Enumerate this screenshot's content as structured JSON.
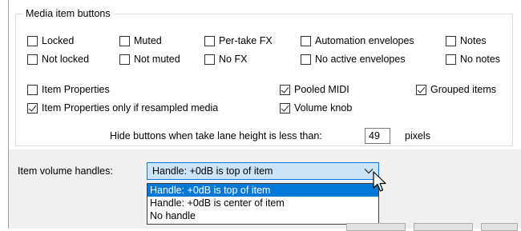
{
  "media_item_buttons": {
    "title": "Media item buttons",
    "row1": [
      {
        "label": "Locked",
        "checked": false
      },
      {
        "label": "Muted",
        "checked": false
      },
      {
        "label": "Per-take FX",
        "checked": false
      },
      {
        "label": "Automation envelopes",
        "checked": false
      },
      {
        "label": "Notes",
        "checked": false
      }
    ],
    "row2": [
      {
        "label": "Not locked",
        "checked": false
      },
      {
        "label": "Not muted",
        "checked": false
      },
      {
        "label": "No FX",
        "checked": false
      },
      {
        "label": "No active envelopes",
        "checked": false
      },
      {
        "label": "No notes",
        "checked": false
      }
    ],
    "item_properties": {
      "label": "Item Properties",
      "checked": false
    },
    "pooled_midi": {
      "label": "Pooled MIDI",
      "checked": true
    },
    "grouped_items": {
      "label": "Grouped items",
      "checked": true
    },
    "item_properties_resampled": {
      "label": "Item Properties only if resampled media",
      "checked": true
    },
    "volume_knob": {
      "label": "Volume knob",
      "checked": true
    },
    "hide_buttons": {
      "label": "Hide buttons when take lane height is less than:",
      "value": "49",
      "unit": "pixels"
    }
  },
  "item_volume_handles": {
    "label": "Item volume handles:",
    "selected": "Handle: +0dB is top of item",
    "options": [
      "Handle: +0dB is top of item",
      "Handle: +0dB is center of item",
      "No handle"
    ],
    "highlighted_index": 0
  },
  "colors": {
    "accent": "#0078d7",
    "combo_background": "#cce4f7",
    "panel_background": "#f0f0f0"
  }
}
